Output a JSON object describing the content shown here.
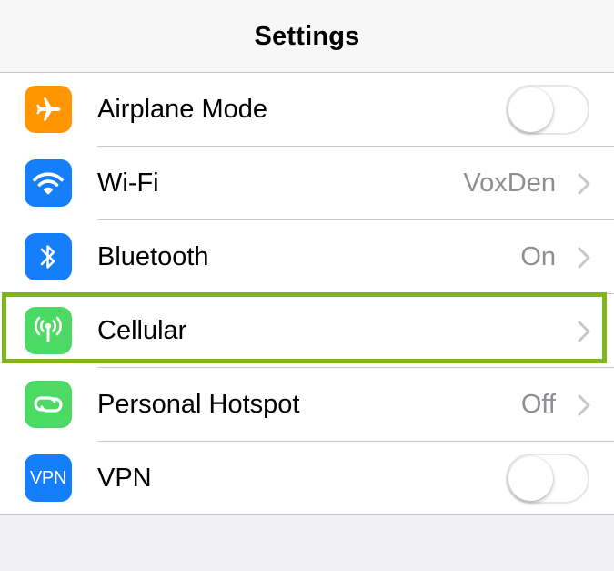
{
  "header": {
    "title": "Settings"
  },
  "colors": {
    "airplane": "#ff9500",
    "wifi": "#147efb",
    "bluetooth": "#147efb",
    "cellular": "#4cd964",
    "hotspot": "#4cd964",
    "vpn": "#147efb",
    "highlight": "#80b51b"
  },
  "rows": [
    {
      "label": "Airplane Mode",
      "icon": "airplane-icon",
      "control": "toggle",
      "on": false
    },
    {
      "label": "Wi-Fi",
      "icon": "wifi-icon",
      "value": "VoxDen",
      "control": "chevron"
    },
    {
      "label": "Bluetooth",
      "icon": "bluetooth-icon",
      "value": "On",
      "control": "chevron"
    },
    {
      "label": "Cellular",
      "icon": "cellular-antenna-icon",
      "control": "chevron",
      "highlighted": true
    },
    {
      "label": "Personal Hotspot",
      "icon": "hotspot-link-icon",
      "value": "Off",
      "control": "chevron"
    },
    {
      "label": "VPN",
      "icon": "vpn-icon",
      "icon_text": "VPN",
      "control": "toggle",
      "on": false
    }
  ]
}
